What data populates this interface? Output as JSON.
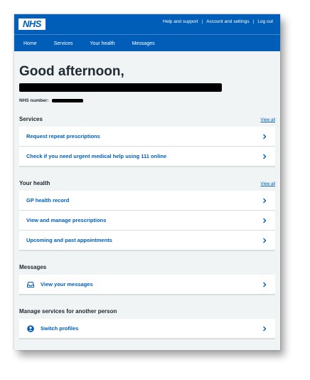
{
  "header": {
    "logo": "NHS",
    "links": [
      "Help and support",
      "Account and settings",
      "Log out"
    ],
    "separator": "|",
    "nav": [
      "Home",
      "Services",
      "Your health",
      "Messages"
    ]
  },
  "greeting": "Good afternoon,",
  "nhs_number_label": "NHS number:",
  "services": {
    "title": "Services",
    "view_all": "View all",
    "items": [
      "Request repeat prescriptions",
      "Check if you need urgent medical help using 111 online"
    ]
  },
  "your_health": {
    "title": "Your health",
    "view_all": "View all",
    "items": [
      "GP health record",
      "View and manage prescriptions",
      "Upcoming and past appointments"
    ]
  },
  "messages": {
    "title": "Messages",
    "item": "View your messages",
    "icon": "inbox-icon"
  },
  "manage": {
    "title": "Manage services for another person",
    "item": "Switch profiles",
    "icon": "switch-profile-icon"
  },
  "colors": {
    "nhs_blue": "#005eb8",
    "background": "#f0f4f5",
    "text": "#212b32"
  }
}
